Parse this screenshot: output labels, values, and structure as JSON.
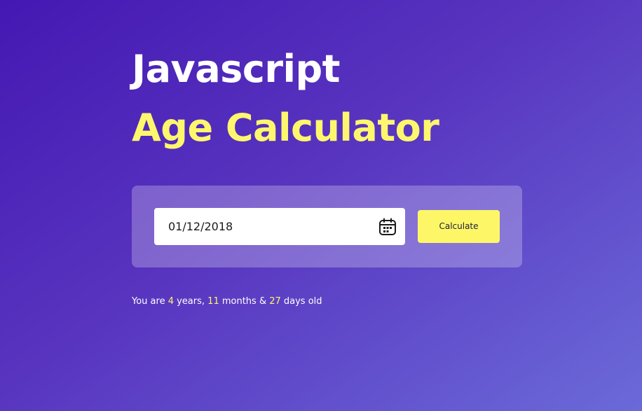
{
  "title": {
    "line1": "Javascript",
    "line2": "Age Calculator"
  },
  "form": {
    "date_value": "01/12/2018",
    "calculate_label": "Calculate"
  },
  "result": {
    "prefix": "You are ",
    "years": "4",
    "years_label": " years, ",
    "months": "11",
    "months_label": " months & ",
    "days": "27",
    "days_label": " days old"
  },
  "icons": {
    "calendar": "calendar-icon"
  },
  "colors": {
    "background_start": "#4418b3",
    "background_end": "#6b6ad9",
    "accent_yellow": "#fef76d",
    "button_yellow": "#fdf768",
    "text_white": "#ffffff"
  }
}
